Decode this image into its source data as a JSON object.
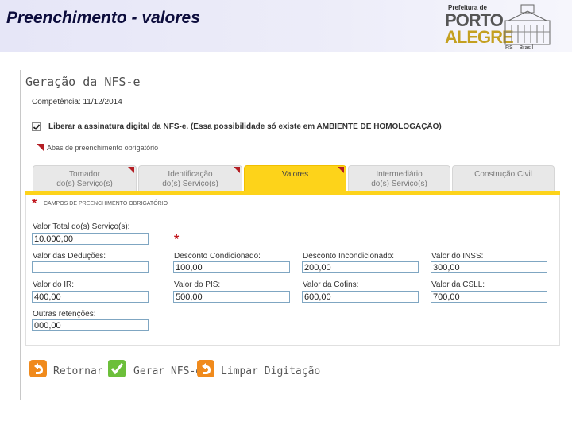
{
  "slide": {
    "title": "Preenchimento - valores"
  },
  "logo": {
    "prefeitura": "Prefeitura de",
    "word1": "PORTO",
    "word2": "ALEGRE",
    "rs": "RS – Brasil"
  },
  "page": {
    "title": "Geração da NFS-e",
    "competencia": "Competência: 11/12/2014",
    "checkbox_label": "Liberar a assinatura digital da NFS-e. (Essa possibilidade só existe em AMBIENTE DE HOMOLOGAÇÃO)",
    "checkbox_checked": true,
    "legend": "Abas de preenchimento obrigatório"
  },
  "tabs": [
    {
      "line1": "Tomador",
      "line2": "do(s) Serviço(s)",
      "active": false,
      "required": true
    },
    {
      "line1": "Identificação",
      "line2": "do(s) Serviço(s)",
      "active": false,
      "required": true
    },
    {
      "line1": "Valores",
      "line2": "",
      "active": true,
      "required": true
    },
    {
      "line1": "Intermediário",
      "line2": "do(s) Serviço(s)",
      "active": false,
      "required": false
    },
    {
      "line1": "Construção Civil",
      "line2": "",
      "active": false,
      "required": false
    }
  ],
  "form": {
    "required_title": "CAMPOS DE PREENCHIMENTO OBRIGATÓRIO",
    "fields": {
      "valor_total": {
        "label": "Valor Total do(s) Serviço(s):",
        "value": "10.000,00"
      },
      "deducoes": {
        "label": "Valor das Deduções:",
        "value": ""
      },
      "desc_cond": {
        "label": "Desconto Condicionado:",
        "value": "100,00"
      },
      "desc_incond": {
        "label": "Desconto Incondicionado:",
        "value": "200,00"
      },
      "inss": {
        "label": "Valor do INSS:",
        "value": "300,00"
      },
      "ir": {
        "label": "Valor do IR:",
        "value": "400,00"
      },
      "pis": {
        "label": "Valor do PIS:",
        "value": "500,00"
      },
      "cofins": {
        "label": "Valor da Cofins:",
        "value": "600,00"
      },
      "csll": {
        "label": "Valor da CSLL:",
        "value": "700,00"
      },
      "outras": {
        "label": "Outras retenções:",
        "value": "000,00"
      }
    }
  },
  "actions": {
    "retornar": "Retornar",
    "gerar": "Gerar NFS-e",
    "limpar": "Limpar Digitação"
  },
  "colors": {
    "tab_active": "#fdd31a",
    "required": "#c0141b",
    "input_border": "#7fa6c2",
    "action_orange": "#f08a1c",
    "action_green": "#5fae2e"
  }
}
